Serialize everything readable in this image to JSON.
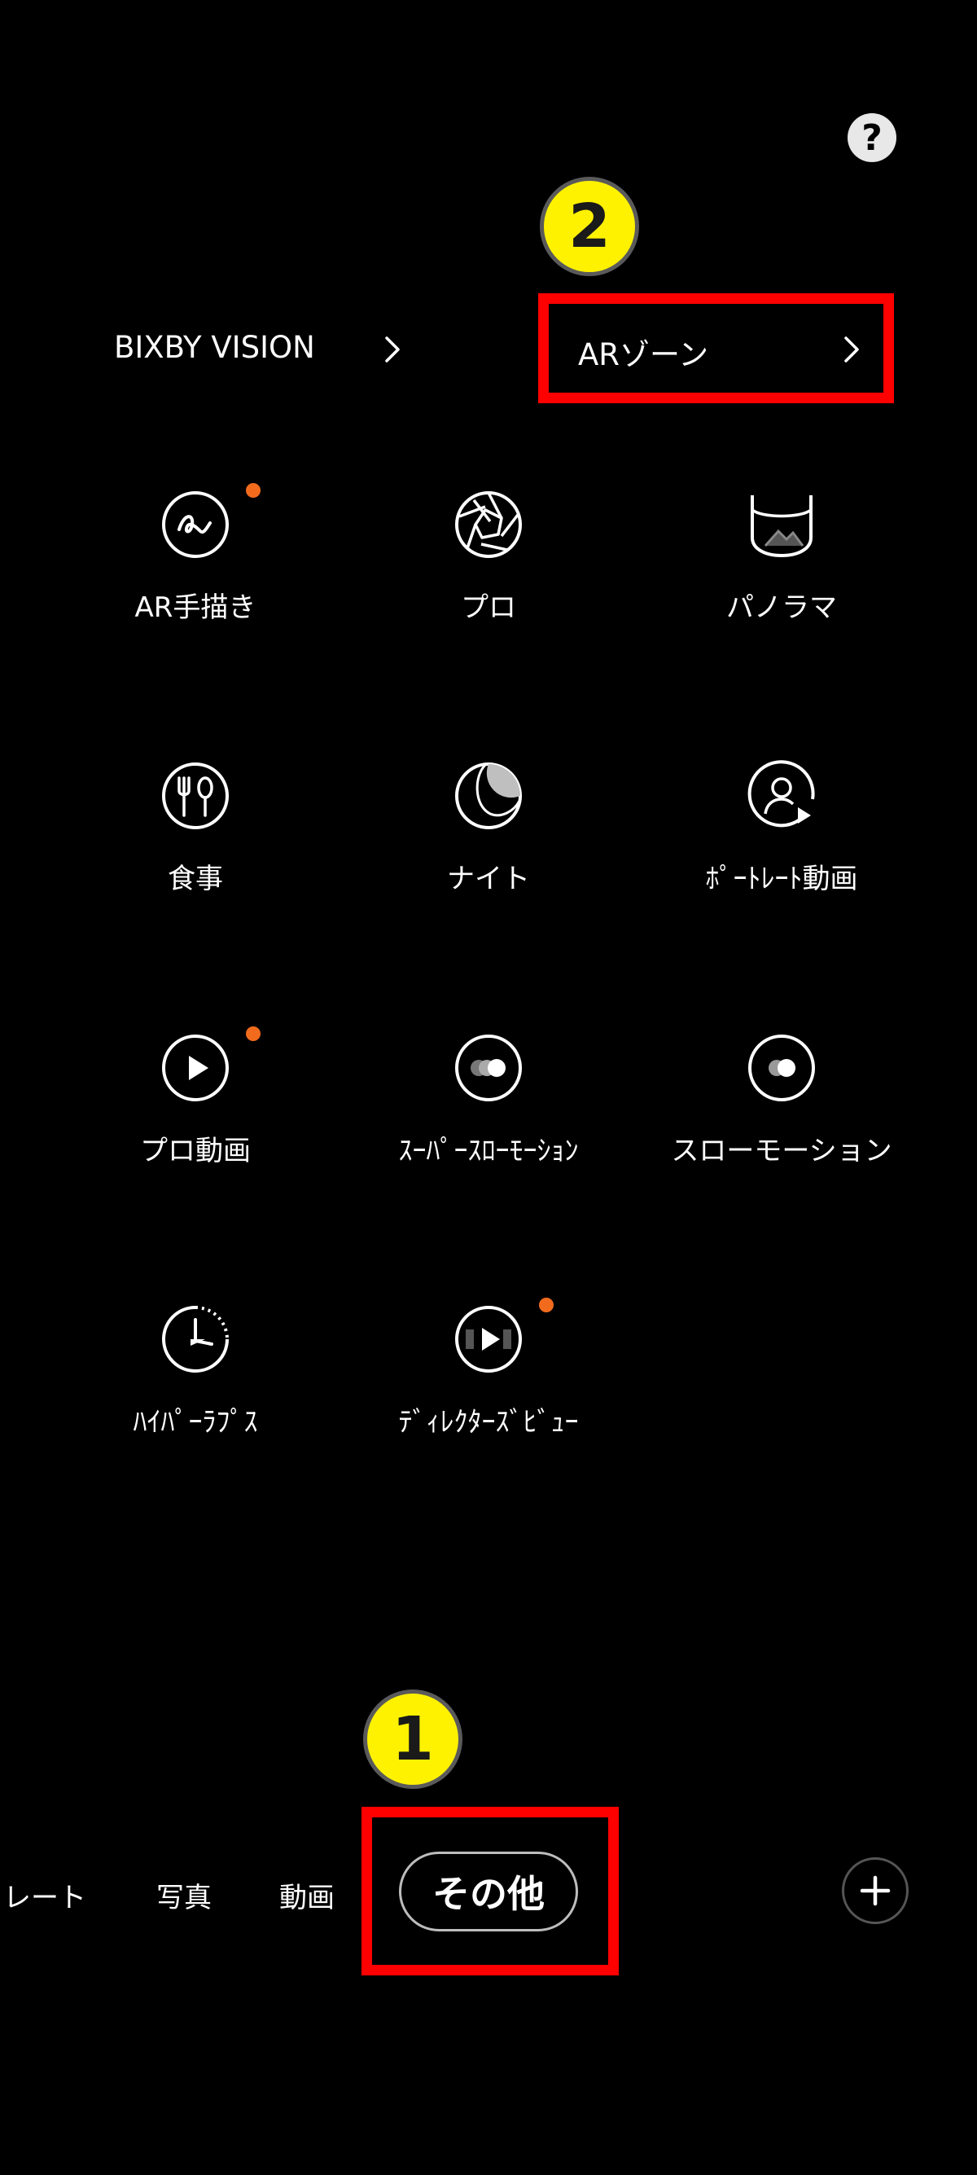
{
  "header": {
    "help_symbol": "?"
  },
  "links": [
    {
      "label": "BIXBY VISION"
    },
    {
      "label": "ARゾーン"
    }
  ],
  "modes": [
    {
      "label": "AR手描き",
      "icon": "ar-doodle-icon",
      "new": true
    },
    {
      "label": "プロ",
      "icon": "aperture-icon",
      "new": false
    },
    {
      "label": "パノラマ",
      "icon": "panorama-icon",
      "new": false
    },
    {
      "label": "食事",
      "icon": "food-icon",
      "new": false
    },
    {
      "label": "ナイト",
      "icon": "moon-icon",
      "new": false
    },
    {
      "label": "ﾎﾟｰﾄﾚｰﾄ動画",
      "icon": "portrait-video-icon",
      "new": false
    },
    {
      "label": "プロ動画",
      "icon": "play-icon",
      "new": true
    },
    {
      "label": "ｽｰﾊﾟｰｽﾛｰﾓｰｼｮﾝ",
      "icon": "super-slow-motion-icon",
      "new": false
    },
    {
      "label": "スローモーション",
      "icon": "slow-motion-icon",
      "new": false
    },
    {
      "label": "ﾊｲﾊﾟｰﾗﾌﾟｽ",
      "icon": "hyperlapse-icon",
      "new": false
    },
    {
      "label": "ﾃﾞｨﾚｸﾀｰｽﾞﾋﾞｭｰ",
      "icon": "directors-view-icon",
      "new": true
    }
  ],
  "bottom_bar": {
    "tabs": [
      "レート",
      "写真",
      "動画"
    ],
    "active_tab": "その他"
  },
  "annotations": {
    "step1": "1",
    "step2": "2",
    "highlight_color": "#ff0000",
    "badge_color": "#fff200"
  },
  "colors": {
    "background": "#000000",
    "new_dot": "#f26b1d"
  }
}
